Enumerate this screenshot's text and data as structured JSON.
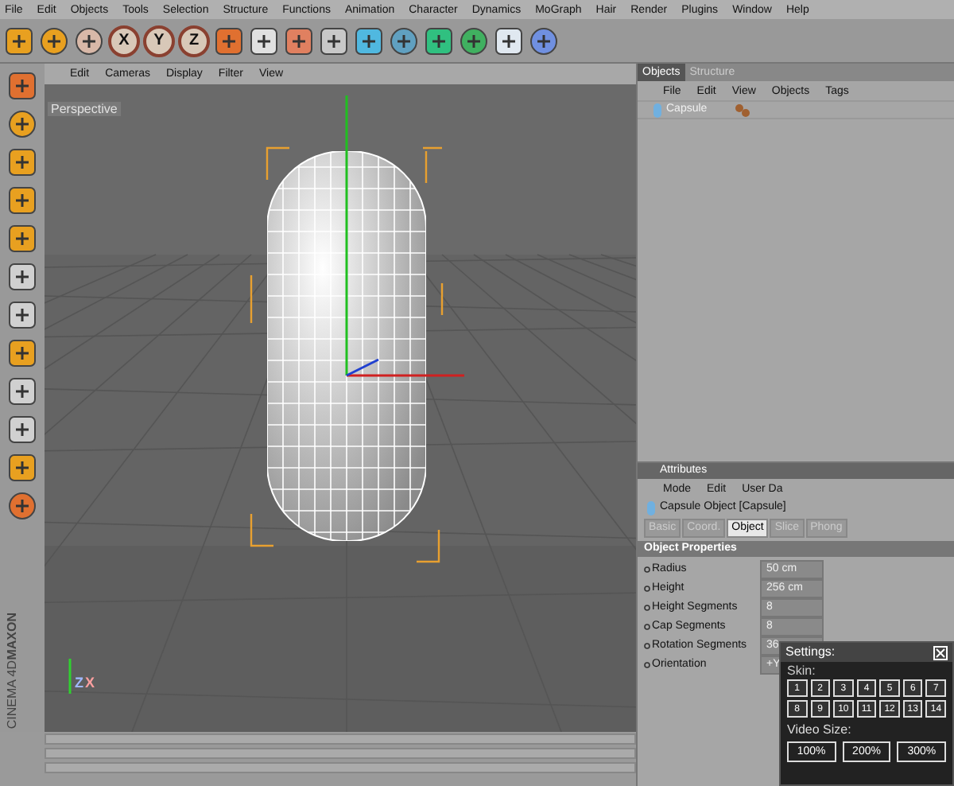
{
  "menu_bar": [
    "File",
    "Edit",
    "Objects",
    "Tools",
    "Selection",
    "Structure",
    "Functions",
    "Animation",
    "Character",
    "Dynamics",
    "MoGraph",
    "Hair",
    "Render",
    "Plugins",
    "Window",
    "Help"
  ],
  "axis_buttons": [
    "X",
    "Y",
    "Z"
  ],
  "viewport": {
    "menu": [
      "Edit",
      "Cameras",
      "Display",
      "Filter",
      "View"
    ],
    "label": "Perspective",
    "axis_labels": [
      "Z",
      "X"
    ]
  },
  "objects_panel": {
    "tabs": [
      {
        "label": "Objects",
        "selected": true
      },
      {
        "label": "Structure",
        "selected": false
      }
    ],
    "menu": [
      "File",
      "Edit",
      "View",
      "Objects",
      "Tags"
    ],
    "tree": [
      {
        "name": "Capsule"
      }
    ]
  },
  "attributes": {
    "title": "Attributes",
    "menu": [
      "Mode",
      "Edit",
      "User Da"
    ],
    "object_title": "Capsule Object [Capsule]",
    "tabs": [
      {
        "label": "Basic",
        "selected": false
      },
      {
        "label": "Coord.",
        "selected": false
      },
      {
        "label": "Object",
        "selected": true
      },
      {
        "label": "Slice",
        "selected": false
      },
      {
        "label": "Phong",
        "selected": false
      }
    ],
    "section": "Object Properties",
    "fields": [
      {
        "label": "Radius",
        "value": "50 cm"
      },
      {
        "label": "Height",
        "value": "256 cm"
      },
      {
        "label": "Height Segments",
        "value": "8"
      },
      {
        "label": "Cap Segments",
        "value": "8"
      },
      {
        "label": "Rotation Segments",
        "value": "36"
      },
      {
        "label": "Orientation",
        "value": "+Y"
      }
    ]
  },
  "settings": {
    "title": "Settings:",
    "skin_label": "Skin:",
    "skins": [
      "1",
      "2",
      "3",
      "4",
      "5",
      "6",
      "7",
      "8",
      "9",
      "10",
      "11",
      "12",
      "13",
      "14"
    ],
    "video_label": "Video Size:",
    "video_sizes": [
      "100%",
      "200%",
      "300%"
    ]
  },
  "brand": [
    "MAXON",
    "CINEMA 4D"
  ]
}
